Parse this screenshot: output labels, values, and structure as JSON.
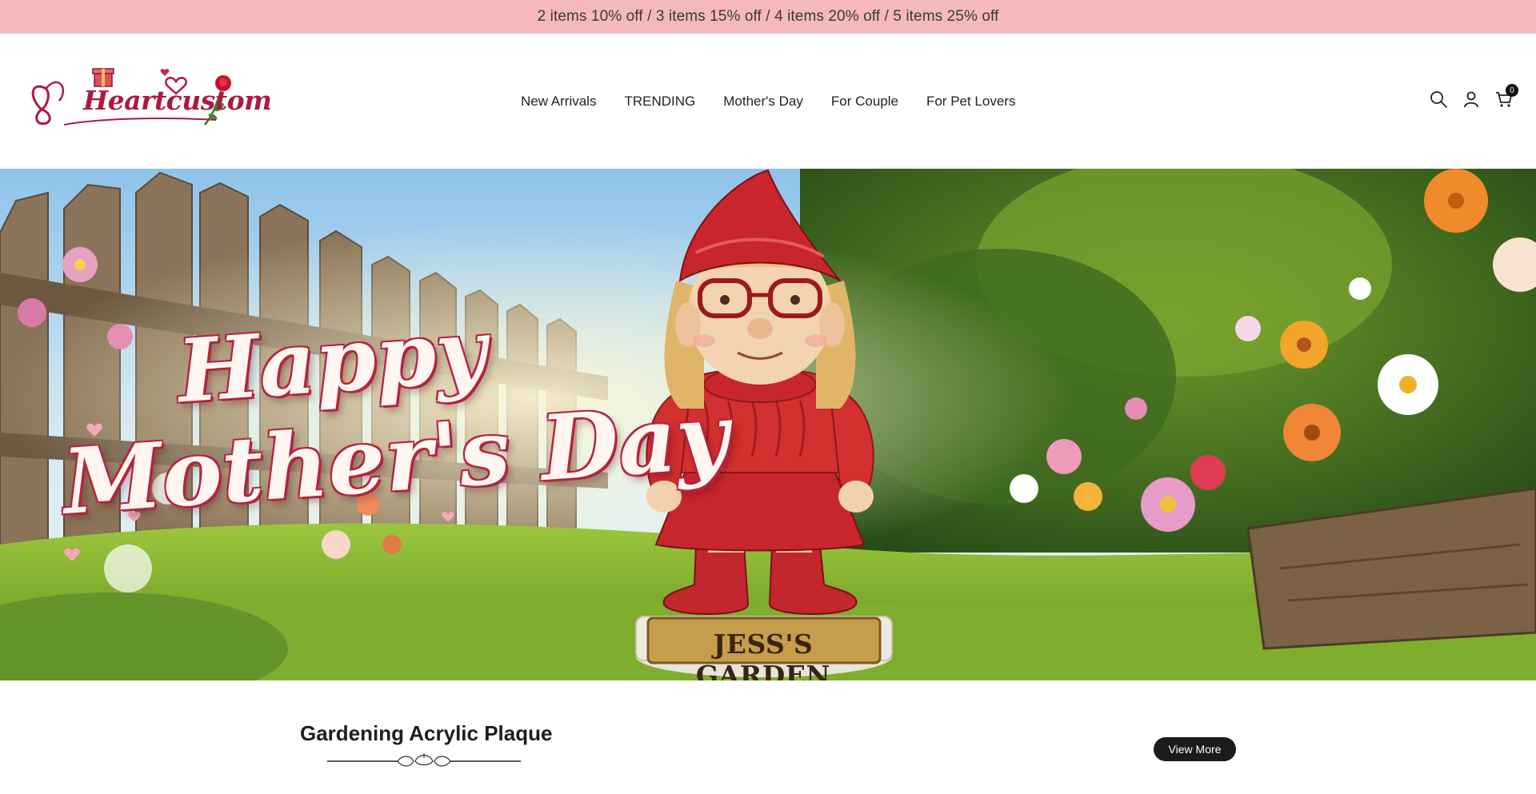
{
  "announcement": {
    "text": "2 items 10% off / 3 items 15% off / 4 items 20% off / 5 items 25% off",
    "bg_color": "#f6b9bb"
  },
  "header": {
    "logo_text": "Heartcustom",
    "nav": [
      "New Arrivals",
      "TRENDING",
      "Mother's Day",
      "For Couple",
      "For Pet Lovers"
    ],
    "icons": [
      "search-icon",
      "user-icon",
      "cart-icon"
    ],
    "cart_count": "0"
  },
  "hero": {
    "title_line1": "Happy",
    "title_line2": "Mother's Day",
    "plaque_text": "JESS'S GARDEN",
    "accent_color": "#b4243f"
  },
  "section": {
    "title": "Gardening Acrylic Plaque",
    "view_more_label": "View More"
  }
}
